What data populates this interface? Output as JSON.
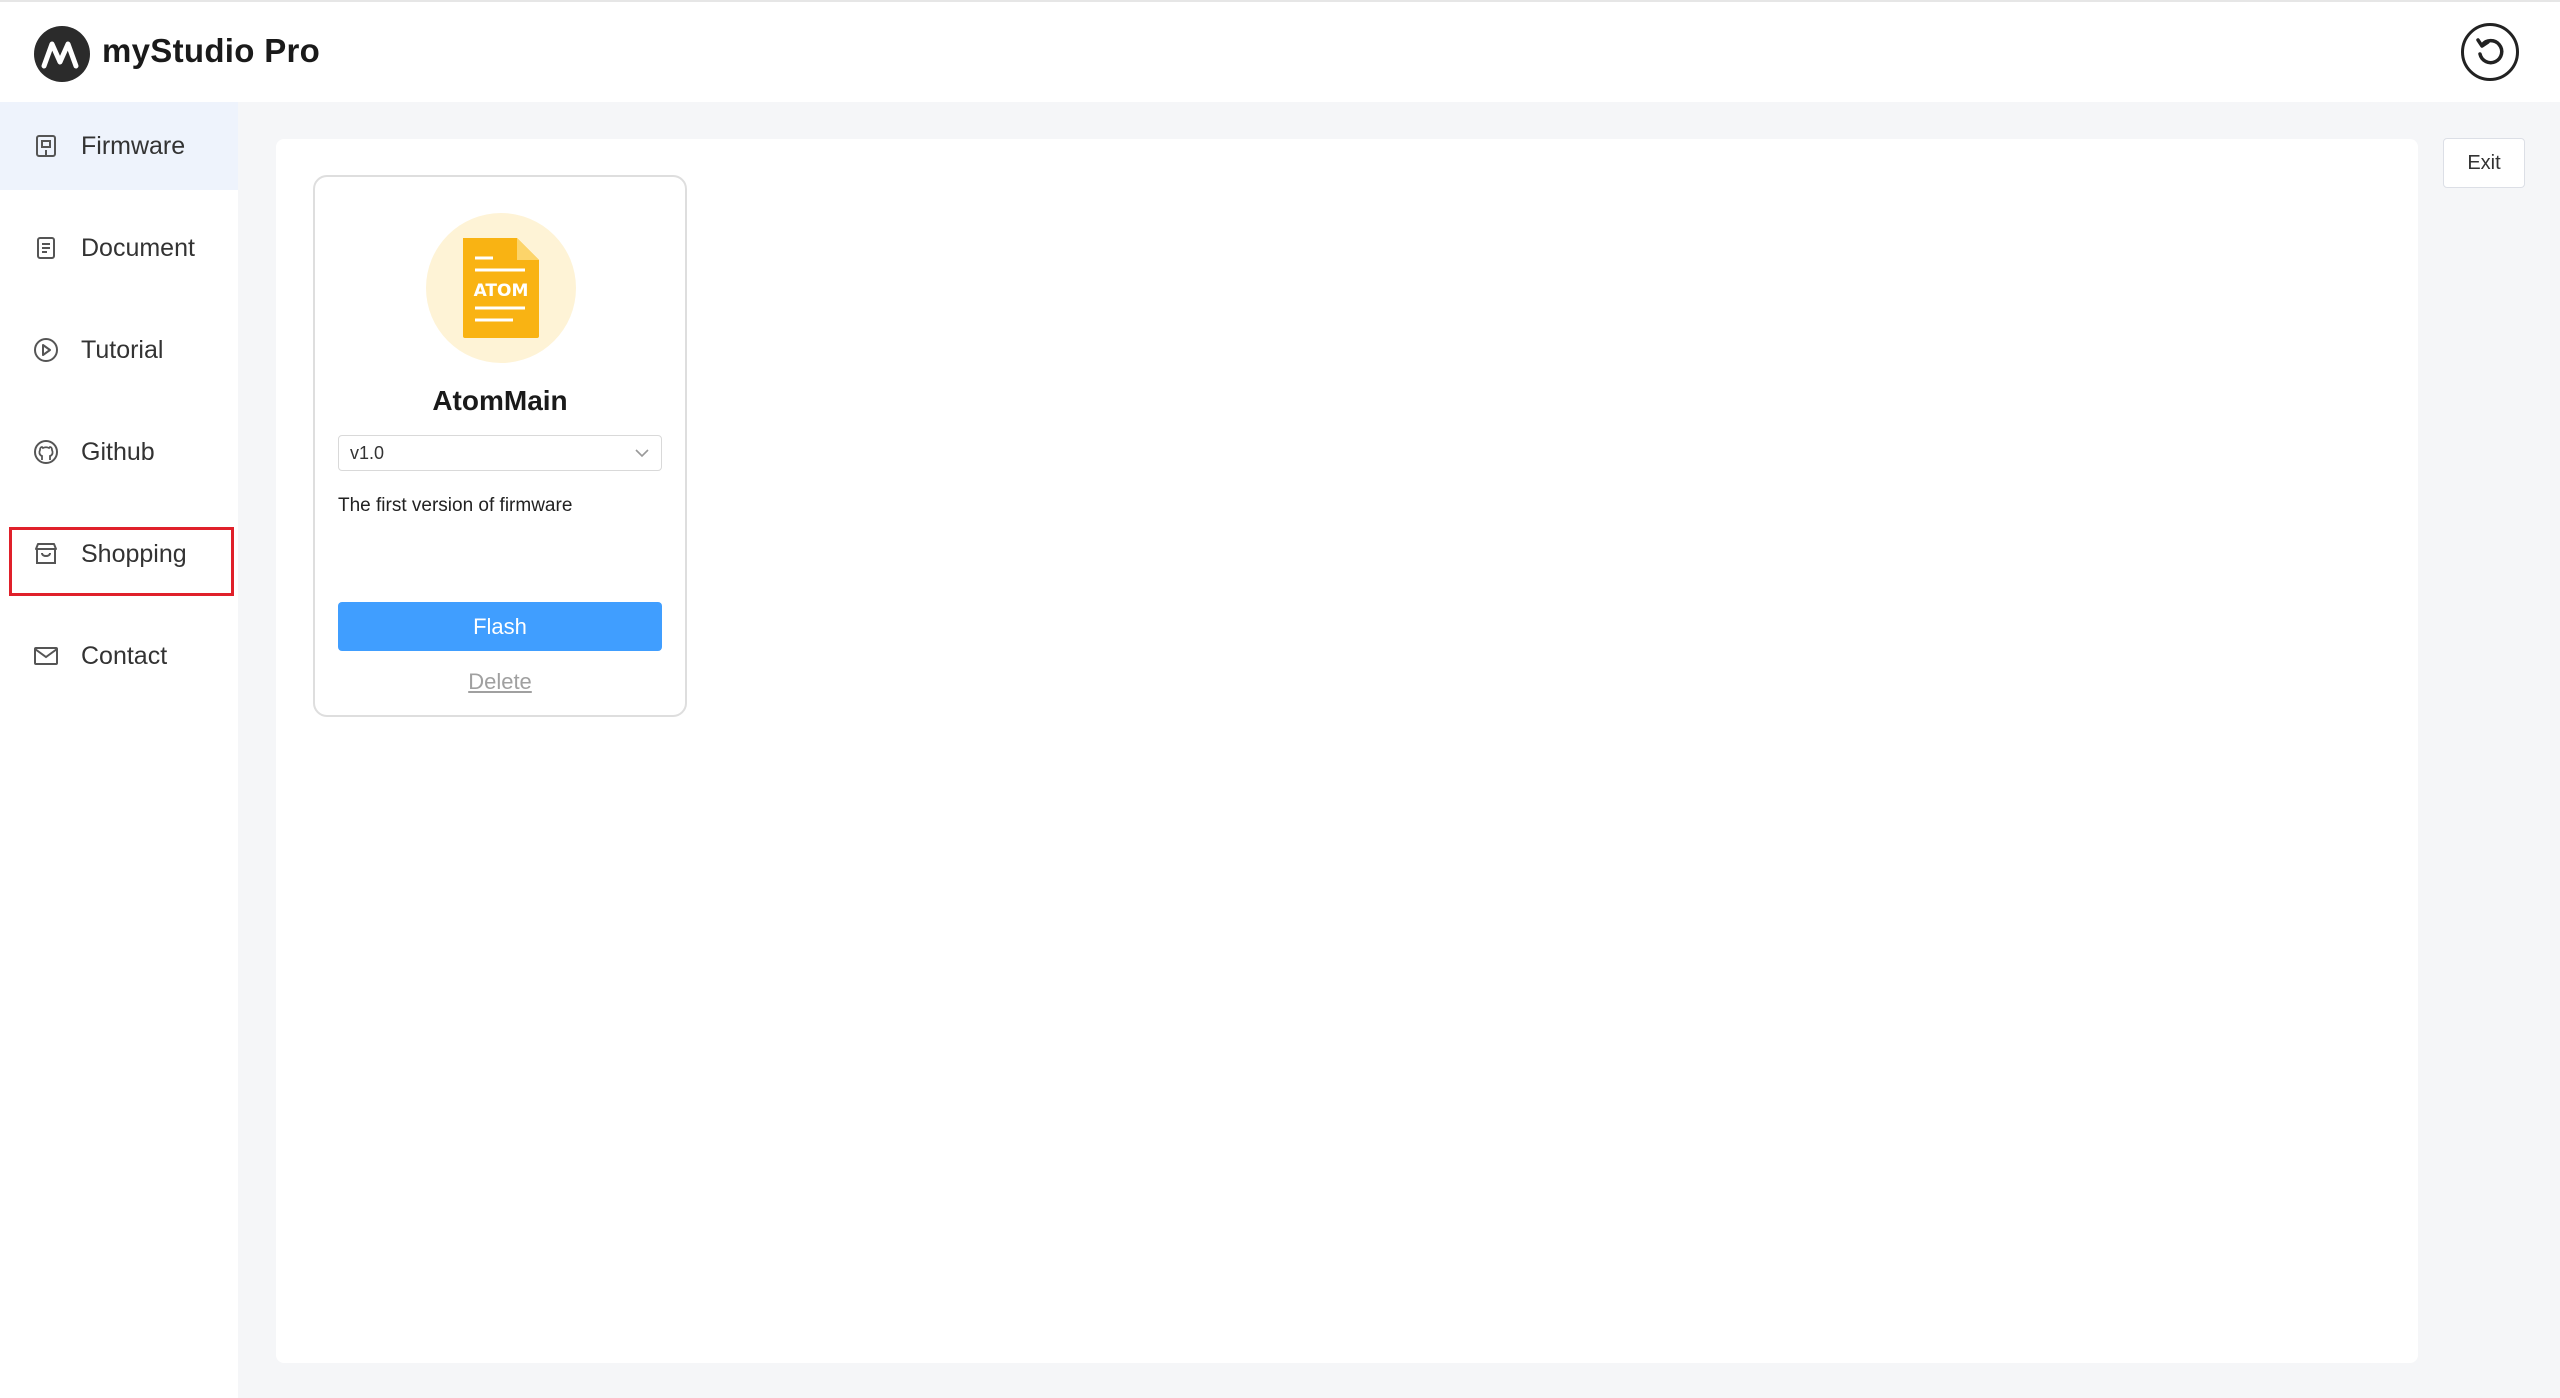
{
  "app": {
    "title": "myStudio Pro",
    "logo_icon": "mystudio-logo-icon",
    "back_icon": "undo-circle-icon"
  },
  "sidebar": {
    "active_index": 0,
    "highlighted_index": 4,
    "items": [
      {
        "label": "Firmware",
        "icon": "firmware-icon"
      },
      {
        "label": "Document",
        "icon": "document-icon"
      },
      {
        "label": "Tutorial",
        "icon": "play-circle-icon"
      },
      {
        "label": "Github",
        "icon": "github-icon"
      },
      {
        "label": "Shopping",
        "icon": "shop-icon"
      },
      {
        "label": "Contact",
        "icon": "mail-icon"
      }
    ]
  },
  "toolbar": {
    "exit_label": "Exit"
  },
  "firmware_cards": [
    {
      "name": "AtomMain",
      "icon_text": "ATOM",
      "version": "v1.0",
      "description": "The first version of firmware",
      "flash_label": "Flash",
      "delete_label": "Delete"
    }
  ],
  "colors": {
    "accent": "#409eff",
    "active_nav_bg": "#eef3fc",
    "highlight_border": "#e0202a",
    "file_icon": "#f9b313",
    "icon_circle_bg": "#fef3d6"
  }
}
